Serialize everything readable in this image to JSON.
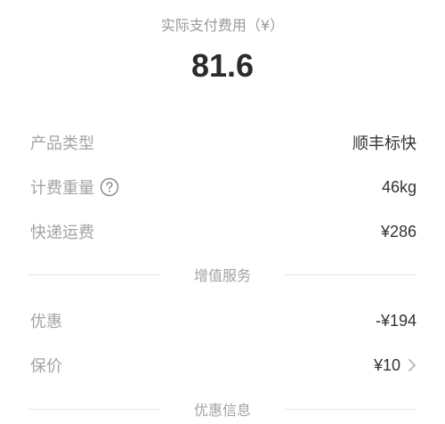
{
  "summary": {
    "label": "实际支付费用（¥）",
    "amount": "81.6"
  },
  "details": {
    "product_type": {
      "label": "产品类型",
      "value": "顺丰标快"
    },
    "billing_weight": {
      "label": "计费重量",
      "value": "46kg",
      "icon": "help-circle-icon"
    },
    "shipping_fee": {
      "label": "快递运费",
      "value": "¥286"
    }
  },
  "sections": {
    "value_added": "增值服务",
    "discount_info": "优惠信息"
  },
  "value_added": {
    "discount": {
      "label": "优惠",
      "value": "-¥194"
    },
    "insurance": {
      "label": "保价",
      "value": "¥10",
      "icon": "chevron-right-icon"
    }
  },
  "colors": {
    "label": "#a3a3a3",
    "value": "#333333",
    "divider": "#e6e6e6"
  }
}
